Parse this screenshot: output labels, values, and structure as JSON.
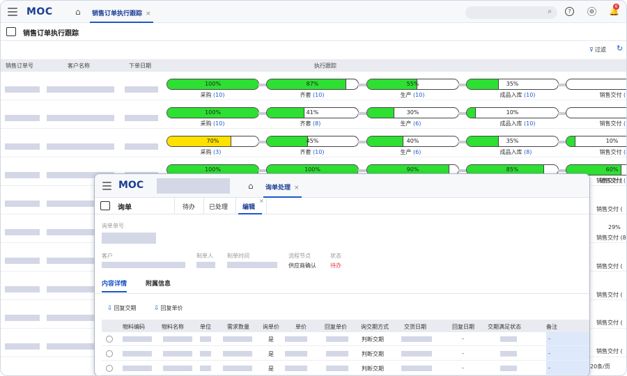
{
  "app": {
    "logo": "MOC",
    "tab": "销售订单执行跟踪",
    "tab_close": "×",
    "notif_count": "6",
    "help_icon": "?",
    "settings_icon": "gear-icon"
  },
  "page": {
    "title": "销售订单执行跟踪",
    "filter_label": "过滤",
    "refresh_icon": "refresh-icon"
  },
  "table": {
    "headers": [
      "销售订单号",
      "客户名称",
      "下单日期",
      "执行跟踪"
    ],
    "rows": [
      {
        "stages": [
          {
            "pct": "100%",
            "fill": 1.0,
            "color": "#2de032",
            "label": "采购",
            "count": "10"
          },
          {
            "pct": "87%",
            "fill": 0.87,
            "color": "#2de032",
            "label": "齐套",
            "count": "10"
          },
          {
            "pct": "55%",
            "fill": 0.55,
            "color": "#2de032",
            "label": "生产",
            "count": "10"
          },
          {
            "pct": "35%",
            "fill": 0.35,
            "color": "#2de032",
            "label": "成品入库",
            "count": "10"
          },
          {
            "pct": "",
            "fill": 0,
            "color": "#2de032",
            "label": "销售交付",
            "count": "("
          }
        ]
      },
      {
        "stages": [
          {
            "pct": "100%",
            "fill": 1.0,
            "color": "#2de032",
            "label": "采购",
            "count": "10"
          },
          {
            "pct": "41%",
            "fill": 0.41,
            "color": "#2de032",
            "label": "齐套",
            "count": "8"
          },
          {
            "pct": "30%",
            "fill": 0.3,
            "color": "#2de032",
            "label": "生产",
            "count": "6"
          },
          {
            "pct": "10%",
            "fill": 0.1,
            "color": "#2de032",
            "label": "成品入库",
            "count": "10"
          },
          {
            "pct": "",
            "fill": 0,
            "color": "#2de032",
            "label": "销售交付",
            "count": "("
          }
        ]
      },
      {
        "stages": [
          {
            "pct": "70%",
            "fill": 0.7,
            "color": "#ffe100",
            "label": "采购",
            "count": "3"
          },
          {
            "pct": "45%",
            "fill": 0.45,
            "color": "#2de032",
            "label": "齐套",
            "count": "10"
          },
          {
            "pct": "40%",
            "fill": 0.4,
            "color": "#2de032",
            "label": "生产",
            "count": "6"
          },
          {
            "pct": "35%",
            "fill": 0.35,
            "color": "#2de032",
            "label": "成品入库",
            "count": "8"
          },
          {
            "pct": "10%",
            "fill": 0.1,
            "color": "#2de032",
            "label": "销售交付",
            "count": "8"
          }
        ]
      },
      {
        "stages": [
          {
            "pct": "100%",
            "fill": 1.0,
            "color": "#2de032",
            "label": "",
            "count": ""
          },
          {
            "pct": "100%",
            "fill": 1.0,
            "color": "#2de032",
            "label": "",
            "count": ""
          },
          {
            "pct": "90%",
            "fill": 0.9,
            "color": "#2de032",
            "label": "",
            "count": ""
          },
          {
            "pct": "85%",
            "fill": 0.85,
            "color": "#2de032",
            "label": "",
            "count": ""
          },
          {
            "pct": "60%",
            "fill": 0.6,
            "color": "#2de032",
            "label": "销售交付",
            "count": "("
          }
        ]
      }
    ],
    "right_col": [
      {
        "label": "销售交付",
        "count": "("
      },
      {
        "label": "销售交付",
        "count": "("
      },
      {
        "pct": "29%"
      },
      {
        "label": "销售交付",
        "count": "8"
      },
      {
        "label": "销售交付",
        "count": "("
      },
      {
        "label": "销售交付",
        "count": "("
      },
      {
        "label": "销售交付",
        "count": "("
      },
      {
        "label": "销售交付",
        "count": "("
      },
      {
        "label": "销售交付",
        "count": "("
      }
    ],
    "pager": "20条/页"
  },
  "modal": {
    "logo": "MOC",
    "tab": "询单处理",
    "tab_close": "×",
    "title": "询单",
    "subtabs": [
      "待办",
      "已处理",
      "编辑"
    ],
    "subtab_close": "×",
    "fields": {
      "inquiry_no_label": "询单单号",
      "customer_label": "客户",
      "creator_label": "制单人",
      "created_time_label": "制单时间",
      "flow_node_label": "流程节点",
      "flow_node_value": "供应商确认",
      "status_label": "状态",
      "status_value": "待办"
    },
    "detail_tabs": [
      "内容详情",
      "附属信息"
    ],
    "actions": [
      "回复交期",
      "回复单价"
    ],
    "columns": [
      "物料编码",
      "物料名称",
      "单位",
      "需求数量",
      "询单价",
      "单价",
      "回复单价",
      "询交期方式",
      "交货日期",
      "回复日期",
      "交期满足状态",
      "备注"
    ],
    "rows": [
      {
        "inq_price": "是",
        "method": "判断交期",
        "reply_date": "-",
        "remark": "-"
      },
      {
        "inq_price": "是",
        "method": "判断交期",
        "reply_date": "-",
        "remark": "-"
      },
      {
        "inq_price": "是",
        "method": "判断交期",
        "reply_date": "-",
        "remark": "-"
      }
    ]
  }
}
